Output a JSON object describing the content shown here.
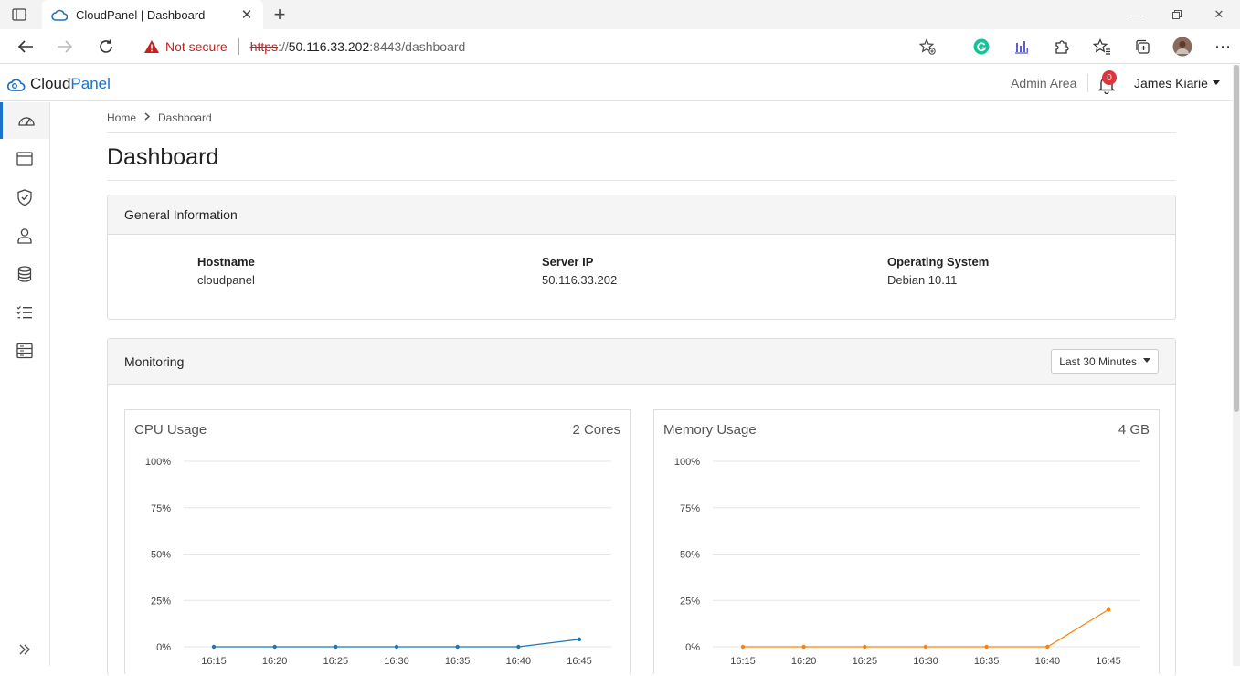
{
  "browser": {
    "tab_title": "CloudPanel | Dashboard",
    "not_secure": "Not secure",
    "url_scheme": "https",
    "url_sep": "://",
    "url_host": "50.116.33.202",
    "url_rest": ":8443/dashboard"
  },
  "header": {
    "brand_prefix": "Cloud",
    "brand_suffix": "Panel",
    "admin_area": "Admin Area",
    "notifications_count": "0",
    "user_name": "James Kiarie"
  },
  "sidebar": {
    "items": [
      {
        "icon": "dashboard-gauge-icon"
      },
      {
        "icon": "sites-window-icon"
      },
      {
        "icon": "security-shield-icon"
      },
      {
        "icon": "users-person-icon"
      },
      {
        "icon": "database-icon"
      },
      {
        "icon": "tasks-list-icon"
      },
      {
        "icon": "server-rack-icon"
      }
    ],
    "expand_icon": "double-chevron-right-icon"
  },
  "breadcrumb": {
    "home": "Home",
    "current": "Dashboard"
  },
  "page_title": "Dashboard",
  "general_info": {
    "title": "General Information",
    "fields": [
      {
        "label": "Hostname",
        "value": "cloudpanel"
      },
      {
        "label": "Server IP",
        "value": "50.116.33.202"
      },
      {
        "label": "Operating System",
        "value": "Debian 10.11"
      }
    ]
  },
  "monitoring": {
    "title": "Monitoring",
    "range_selected": "Last 30 Minutes"
  },
  "chart_data": [
    {
      "type": "line",
      "title": "CPU Usage",
      "meta": "2 Cores",
      "x": [
        "16:15",
        "16:20",
        "16:25",
        "16:30",
        "16:35",
        "16:40",
        "16:45"
      ],
      "series": [
        {
          "values": [
            0,
            0,
            0,
            0,
            0,
            0,
            4
          ],
          "color": "#1f77b4"
        }
      ],
      "yticks": [
        "0%",
        "25%",
        "50%",
        "75%",
        "100%"
      ],
      "ylim": [
        0,
        100
      ],
      "grid": true
    },
    {
      "type": "line",
      "title": "Memory Usage",
      "meta": "4 GB",
      "x": [
        "16:15",
        "16:20",
        "16:25",
        "16:30",
        "16:35",
        "16:40",
        "16:45"
      ],
      "series": [
        {
          "values": [
            0,
            0,
            0,
            0,
            0,
            0,
            20
          ],
          "color": "#ff7f0e"
        }
      ],
      "yticks": [
        "0%",
        "25%",
        "50%",
        "75%",
        "100%"
      ],
      "ylim": [
        0,
        100
      ],
      "grid": true
    }
  ]
}
